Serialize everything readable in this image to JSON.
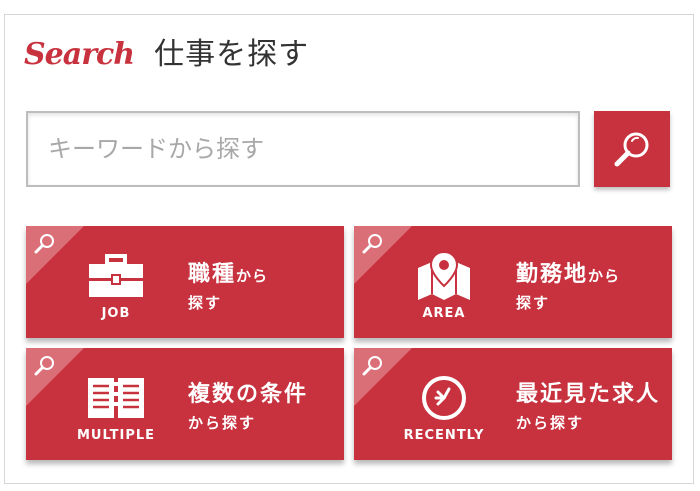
{
  "header": {
    "logo_text": "Search",
    "title": "仕事を探す"
  },
  "search": {
    "placeholder": "キーワードから探す",
    "value": "",
    "button_icon": "magnifier-icon"
  },
  "tiles": [
    {
      "id": "job",
      "caption": "JOB",
      "main": "職種",
      "main_suffix": "から",
      "sub": "探す",
      "icon": "briefcase-icon"
    },
    {
      "id": "area",
      "caption": "AREA",
      "main": "勤務地",
      "main_suffix": "から",
      "sub": "探す",
      "icon": "map-pin-icon"
    },
    {
      "id": "multiple",
      "caption": "MULTIPLE",
      "main": "複数の条件",
      "main_suffix": "",
      "sub": "から探す",
      "icon": "list-icon"
    },
    {
      "id": "recently",
      "caption": "RECENTLY",
      "main": "最近見た求人",
      "main_suffix": "",
      "sub": "から探す",
      "icon": "clock-icon"
    }
  ],
  "colors": {
    "brand_red": "#c8323e",
    "corner_red": "#db6f78",
    "text_dark": "#333333",
    "placeholder_gray": "#a8a8a8"
  }
}
